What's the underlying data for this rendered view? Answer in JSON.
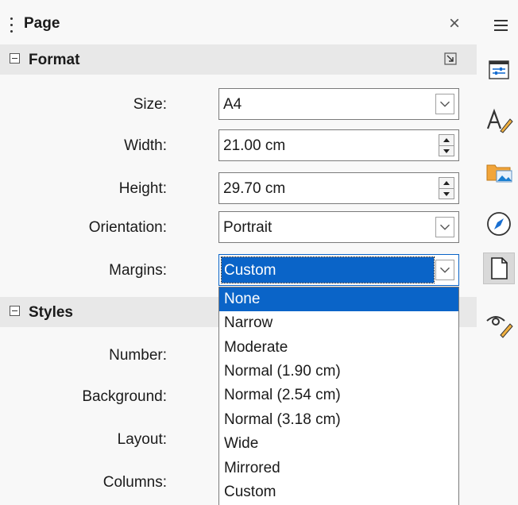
{
  "panel": {
    "title": "Page",
    "close_glyph": "×"
  },
  "format": {
    "title": "Format",
    "size": {
      "label": "Size:",
      "value": "A4"
    },
    "width": {
      "label": "Width:",
      "value": "21.00 cm"
    },
    "height": {
      "label": "Height:",
      "value": "29.70 cm"
    },
    "orientation": {
      "label": "Orientation:",
      "value": "Portrait"
    },
    "margins": {
      "label": "Margins:",
      "value": "Custom"
    }
  },
  "styles": {
    "title": "Styles",
    "number_label": "Number:",
    "background_label": "Background:",
    "layout_label": "Layout:",
    "columns_label": "Columns:"
  },
  "margins_options": [
    "None",
    "Narrow",
    "Moderate",
    "Normal (1.90 cm)",
    "Normal (2.54 cm)",
    "Normal (3.18 cm)",
    "Wide",
    "Mirrored",
    "Custom"
  ],
  "margins_highlighted": "None",
  "sidebar": {
    "icons": [
      "menu-icon",
      "properties-icon",
      "styles-icon",
      "gallery-icon",
      "navigator-icon",
      "page-icon",
      "manage-changes-icon"
    ]
  },
  "colors": {
    "accent": "#0a64c8",
    "panel_bg": "#f8f8f8",
    "section_bg": "#e8e8e8"
  }
}
